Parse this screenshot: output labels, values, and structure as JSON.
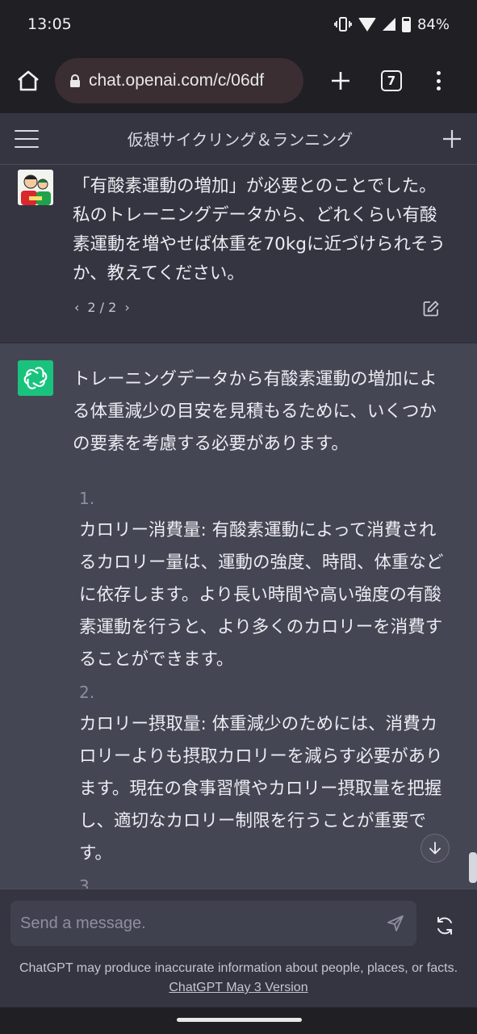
{
  "status_bar": {
    "time": "13:05",
    "battery": "84%"
  },
  "browser": {
    "url": "chat.openai.com/c/06df",
    "tab_count": "7"
  },
  "header": {
    "title": "仮想サイクリング＆ランニング"
  },
  "user_message": {
    "text": "「有酸素運動の増加」が必要とのことでした。私のトレーニングデータから、どれくらい有酸素運動を増やせば体重を70kgに近づけられそうか、教えてください。",
    "pager": "2 / 2"
  },
  "assistant_message": {
    "intro": "トレーニングデータから有酸素運動の増加による体重減少の目安を見積もるために、いくつかの要素を考慮する必要があります。",
    "items": [
      {
        "num": "1.",
        "text": "カロリー消費量: 有酸素運動によって消費されるカロリー量は、運動の強度、時間、体重などに依存します。より長い時間や高い強度の有酸素運動を行うと、より多くのカロリーを消費することができます。"
      },
      {
        "num": "2.",
        "text": "カロリー摂取量: 体重減少のためには、消費カロリーよりも摂取カロリーを減らす必要があります。現在の食事習慣やカロリー摂取量を把握し、適切なカロリー制限を行うことが重要です。"
      },
      {
        "num": "3.",
        "text": ""
      }
    ]
  },
  "composer": {
    "placeholder": "Send a message."
  },
  "footer": {
    "disclaimer": "ChatGPT may produce inaccurate information about people, places, or facts.",
    "version_link": "ChatGPT May 3 Version"
  },
  "colors": {
    "accent": "#19c37d",
    "background": "#343541",
    "assistant_bg": "#444654"
  }
}
